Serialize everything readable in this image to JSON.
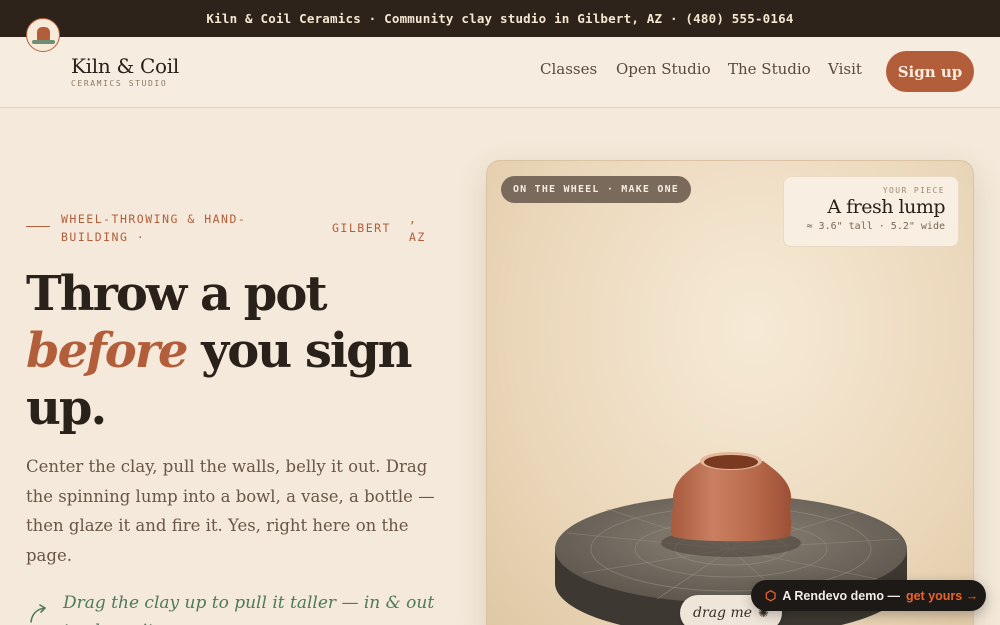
{
  "announcement": "Kiln & Coil Ceramics · Community clay studio in Gilbert, AZ · (480) 555-0164",
  "nav": {
    "brand_name": "Kiln & Coil",
    "brand_sub": "CERAMICS STUDIO",
    "links": [
      "Classes",
      "Open Studio",
      "The Studio",
      "Visit"
    ],
    "signup": "Sign up"
  },
  "hero": {
    "eyebrow_line1": "WHEEL-THROWING & HAND-",
    "eyebrow_line2": "BUILDING ·",
    "eyebrow_place1": "GILBERT",
    "eyebrow_place_comma": ",",
    "eyebrow_place2": "AZ",
    "headline_1": "Throw a pot",
    "headline_accent": "before",
    "headline_2": " you sign",
    "headline_3": "up.",
    "lead": "Center the clay, pull the walls, belly it out. Drag the spinning lump into a bowl, a vase, a bottle — then glaze it and fire it. Yes, right here on the page.",
    "hint": "Drag the clay up to pull it taller — in & out to shape it"
  },
  "stage": {
    "pill": "ON THE WHEEL · MAKE ONE",
    "piece_label": "YOUR PIECE",
    "piece_name": "A fresh lump",
    "piece_dims": "≈ 3.6\" tall · 5.2\" wide",
    "drag_label": "drag me",
    "drag_icon": "spin-icon"
  },
  "badge": {
    "icon": "hexagon-logo-icon",
    "text": "A Rendevo demo —",
    "cta": "get yours →"
  },
  "colors": {
    "accent": "#b35e3b",
    "dark": "#2d231b",
    "sage": "#4e7a5c",
    "background": "#f4e9da"
  }
}
